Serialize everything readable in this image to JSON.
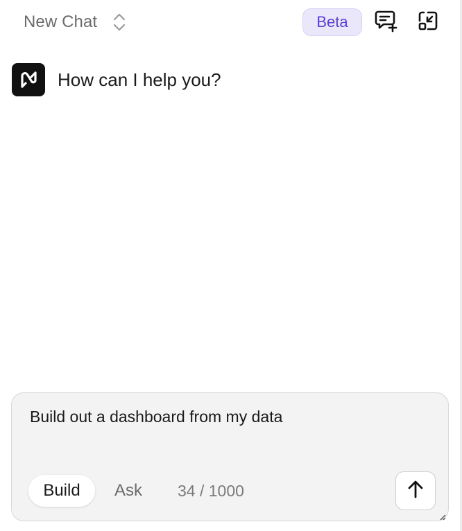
{
  "header": {
    "chat_title": "New Chat",
    "beta_label": "Beta",
    "icons": {
      "selector": "chevron-up-down-icon",
      "new_chat": "message-plus-icon",
      "minimize": "minimize-window-icon"
    }
  },
  "conversation": {
    "greeting": "How can I help you?",
    "avatar_icon": "assistant-logo-icon"
  },
  "composer": {
    "input_value": "Build out a dashboard from my data",
    "modes": [
      {
        "label": "Build",
        "selected": true
      },
      {
        "label": "Ask",
        "selected": false
      }
    ],
    "char_count": "34 / 1000",
    "send_icon": "arrow-up-icon"
  },
  "colors": {
    "beta_bg": "#ebe7fb",
    "beta_text": "#5b3fd0",
    "avatar_bg": "#111111",
    "composer_bg": "#f3f3f3"
  }
}
